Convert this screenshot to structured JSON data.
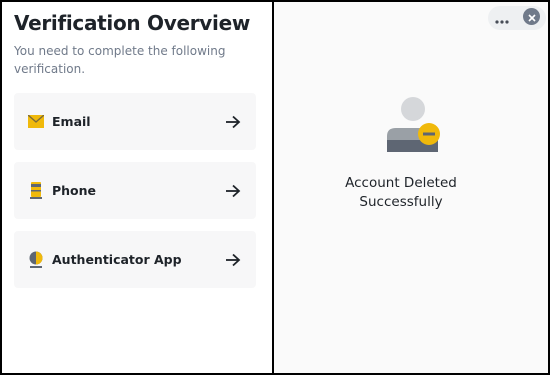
{
  "verification": {
    "title": "Verification Overview",
    "subtitle": "You need to complete the following verification.",
    "items": [
      {
        "label": "Email",
        "icon": "email-icon"
      },
      {
        "label": "Phone",
        "icon": "phone-icon"
      },
      {
        "label": "Authenticator App",
        "icon": "authenticator-icon"
      }
    ]
  },
  "result": {
    "message_line1": "Account Deleted",
    "message_line2": "Successfully"
  },
  "colors": {
    "accent": "#f0b90b",
    "text_primary": "#1e2329",
    "text_secondary": "#707a8a",
    "card_bg": "#f7f7f8",
    "avatar_gray": "#c7c9cc"
  }
}
